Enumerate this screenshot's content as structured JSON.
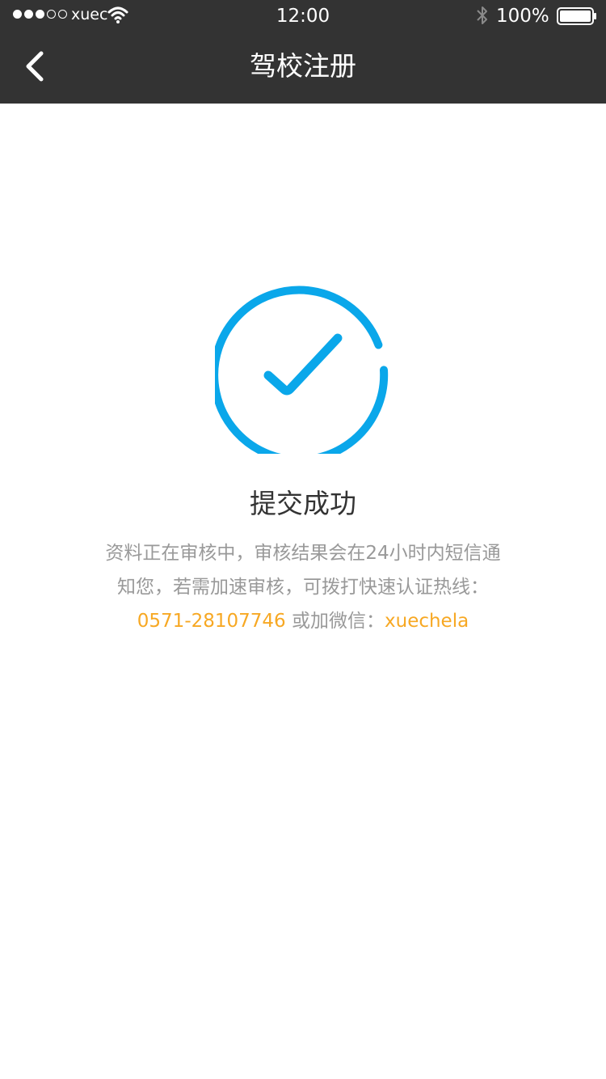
{
  "status_bar": {
    "carrier": "xuec",
    "time": "12:00",
    "battery": "100%"
  },
  "nav": {
    "title": "驾校注册"
  },
  "result": {
    "title": "提交成功",
    "message_line1": "资料正在审核中，审核结果会在24小时内短信通",
    "message_line2": "知您，若需加速审核，可拨打快速认证热线：",
    "phone": "0571-28107746",
    "wechat_prefix": " 或加微信：",
    "wechat_id": "xuechela"
  },
  "colors": {
    "nav_background": "#333333",
    "accent_blue": "#0aa7ea",
    "accent_orange": "#f7a823",
    "text_gray": "#999999"
  },
  "icons": {
    "back": "chevron-left-icon",
    "success": "check-circle-icon"
  }
}
